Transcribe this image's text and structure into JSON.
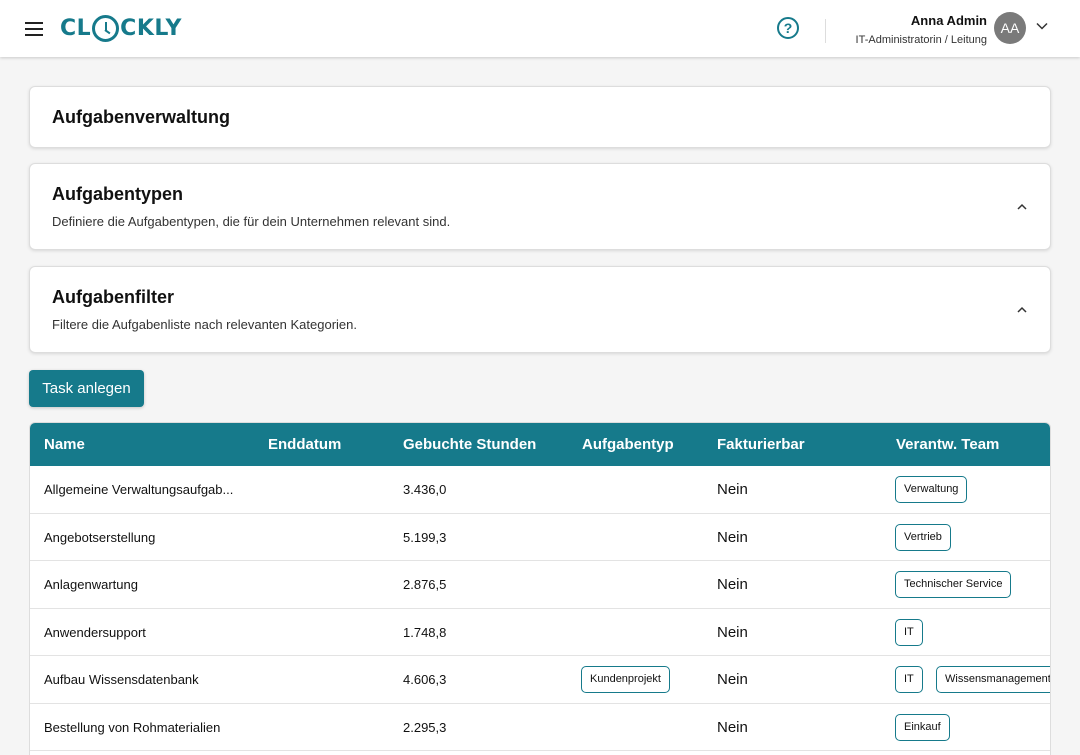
{
  "header": {
    "logo_text": [
      "CL",
      "CKLY"
    ],
    "user_name": "Anna Admin",
    "user_role": "IT-Administratorin / Leitung",
    "avatar_initials": "AA",
    "help_glyph": "?"
  },
  "page": {
    "title": "Aufgabenverwaltung"
  },
  "sections": [
    {
      "title": "Aufgabentypen",
      "subtitle": "Definiere die Aufgabentypen, die für dein Unternehmen relevant sind."
    },
    {
      "title": "Aufgabenfilter",
      "subtitle": "Filtere die Aufgabenliste nach relevanten Kategorien."
    }
  ],
  "create_button": "Task anlegen",
  "table": {
    "columns": [
      "Name",
      "Enddatum",
      "Gebuchte Stunden",
      "Aufgabentyp",
      "Fakturierbar",
      "Verantw. Team"
    ],
    "rows": [
      {
        "name": "Allgemeine Verwaltungsaufgab...",
        "end": "",
        "hours": "3.436,0",
        "type": "",
        "billable": "Nein",
        "teams": [
          "Verwaltung"
        ]
      },
      {
        "name": "Angebotserstellung",
        "end": "",
        "hours": "5.199,3",
        "type": "",
        "billable": "Nein",
        "teams": [
          "Vertrieb"
        ]
      },
      {
        "name": "Anlagenwartung",
        "end": "",
        "hours": "2.876,5",
        "type": "",
        "billable": "Nein",
        "teams": [
          "Technischer Service"
        ]
      },
      {
        "name": "Anwendersupport",
        "end": "",
        "hours": "1.748,8",
        "type": "",
        "billable": "Nein",
        "teams": [
          "IT"
        ]
      },
      {
        "name": "Aufbau Wissensdatenbank",
        "end": "",
        "hours": "4.606,3",
        "type": "Kundenprojekt",
        "billable": "Nein",
        "teams": [
          "IT",
          "Wissensmanagement"
        ]
      },
      {
        "name": "Bestellung von Rohmaterialien",
        "end": "",
        "hours": "2.295,3",
        "type": "",
        "billable": "Nein",
        "teams": [
          "Einkauf"
        ]
      }
    ]
  },
  "icons": {
    "menu": "hamburger-icon",
    "help": "help-circle-icon",
    "chevron_down": "chevron-down-icon",
    "chevron_up": "chevron-up-icon"
  },
  "colors": {
    "accent": "#167a8b"
  }
}
